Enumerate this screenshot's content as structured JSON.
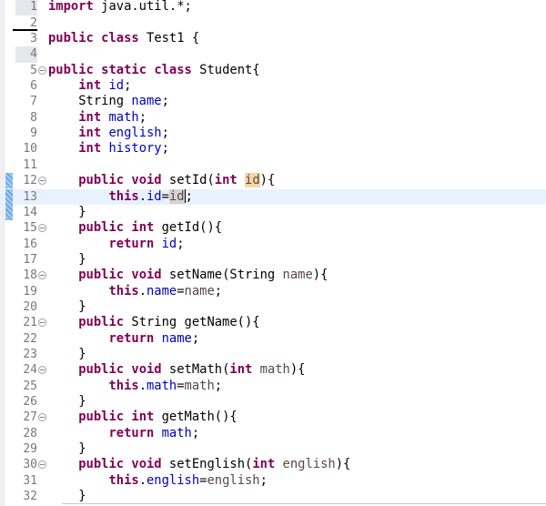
{
  "editor": {
    "current_line": 13,
    "marked_line_numbers": [
      1,
      4
    ],
    "underlined_line_number": 2,
    "selection_marker_lines": [
      12,
      13,
      14
    ],
    "caret": {
      "line": 13,
      "after_token": 4
    },
    "lines": [
      {
        "n": "1",
        "tokens": [
          [
            "k",
            "import"
          ],
          [
            "n",
            " java.util.*;"
          ]
        ]
      },
      {
        "n": "2",
        "tokens": []
      },
      {
        "n": "3",
        "tokens": [
          [
            "k",
            "public"
          ],
          [
            "n",
            " "
          ],
          [
            "k",
            "class"
          ],
          [
            "n",
            " Test1 {"
          ]
        ]
      },
      {
        "n": "4",
        "tokens": []
      },
      {
        "n": "5",
        "fold": true,
        "tokens": [
          [
            "k",
            "public"
          ],
          [
            "n",
            " "
          ],
          [
            "k",
            "static"
          ],
          [
            "n",
            " "
          ],
          [
            "k",
            "class"
          ],
          [
            "n",
            " Student{"
          ]
        ]
      },
      {
        "n": "6",
        "tokens": [
          [
            "n",
            "    "
          ],
          [
            "k",
            "int"
          ],
          [
            "n",
            " "
          ],
          [
            "f",
            "id"
          ],
          [
            "n",
            ";"
          ]
        ]
      },
      {
        "n": "7",
        "tokens": [
          [
            "n",
            "    String "
          ],
          [
            "f",
            "name"
          ],
          [
            "n",
            ";"
          ]
        ]
      },
      {
        "n": "8",
        "tokens": [
          [
            "n",
            "    "
          ],
          [
            "k",
            "int"
          ],
          [
            "n",
            " "
          ],
          [
            "f",
            "math"
          ],
          [
            "n",
            ";"
          ]
        ]
      },
      {
        "n": "9",
        "tokens": [
          [
            "n",
            "    "
          ],
          [
            "k",
            "int"
          ],
          [
            "n",
            " "
          ],
          [
            "f",
            "english"
          ],
          [
            "n",
            ";"
          ]
        ]
      },
      {
        "n": "10",
        "tokens": [
          [
            "n",
            "    "
          ],
          [
            "k",
            "int"
          ],
          [
            "n",
            " "
          ],
          [
            "f",
            "history"
          ],
          [
            "n",
            ";"
          ]
        ]
      },
      {
        "n": "11",
        "tokens": []
      },
      {
        "n": "12",
        "fold": true,
        "tokens": [
          [
            "n",
            "    "
          ],
          [
            "k",
            "public"
          ],
          [
            "n",
            " "
          ],
          [
            "k",
            "void"
          ],
          [
            "n",
            " setId("
          ],
          [
            "k",
            "int"
          ],
          [
            "n",
            " "
          ],
          [
            "hp",
            "id"
          ],
          [
            "n",
            "){"
          ]
        ]
      },
      {
        "n": "13",
        "tokens": [
          [
            "n",
            "        "
          ],
          [
            "k",
            "this"
          ],
          [
            "n",
            "."
          ],
          [
            "f",
            "id"
          ],
          [
            "n",
            "="
          ],
          [
            "hr",
            "id"
          ],
          [
            "n",
            ";"
          ]
        ]
      },
      {
        "n": "14",
        "tokens": [
          [
            "n",
            "    }"
          ]
        ]
      },
      {
        "n": "15",
        "fold": true,
        "tokens": [
          [
            "n",
            "    "
          ],
          [
            "k",
            "public"
          ],
          [
            "n",
            " "
          ],
          [
            "k",
            "int"
          ],
          [
            "n",
            " getId(){"
          ]
        ]
      },
      {
        "n": "16",
        "tokens": [
          [
            "n",
            "        "
          ],
          [
            "k",
            "return"
          ],
          [
            "n",
            " "
          ],
          [
            "f",
            "id"
          ],
          [
            "n",
            ";"
          ]
        ]
      },
      {
        "n": "17",
        "tokens": [
          [
            "n",
            "    }"
          ]
        ]
      },
      {
        "n": "18",
        "fold": true,
        "tokens": [
          [
            "n",
            "    "
          ],
          [
            "k",
            "public"
          ],
          [
            "n",
            " "
          ],
          [
            "k",
            "void"
          ],
          [
            "n",
            " setName(String "
          ],
          [
            "p",
            "name"
          ],
          [
            "n",
            "){"
          ]
        ]
      },
      {
        "n": "19",
        "tokens": [
          [
            "n",
            "        "
          ],
          [
            "k",
            "this"
          ],
          [
            "n",
            "."
          ],
          [
            "f",
            "name"
          ],
          [
            "n",
            "="
          ],
          [
            "p",
            "name"
          ],
          [
            "n",
            ";"
          ]
        ]
      },
      {
        "n": "20",
        "tokens": [
          [
            "n",
            "    }"
          ]
        ]
      },
      {
        "n": "21",
        "fold": true,
        "tokens": [
          [
            "n",
            "    "
          ],
          [
            "k",
            "public"
          ],
          [
            "n",
            " String getName(){"
          ]
        ]
      },
      {
        "n": "22",
        "tokens": [
          [
            "n",
            "        "
          ],
          [
            "k",
            "return"
          ],
          [
            "n",
            " "
          ],
          [
            "f",
            "name"
          ],
          [
            "n",
            ";"
          ]
        ]
      },
      {
        "n": "23",
        "tokens": [
          [
            "n",
            "    }"
          ]
        ]
      },
      {
        "n": "24",
        "fold": true,
        "tokens": [
          [
            "n",
            "    "
          ],
          [
            "k",
            "public"
          ],
          [
            "n",
            " "
          ],
          [
            "k",
            "void"
          ],
          [
            "n",
            " setMath("
          ],
          [
            "k",
            "int"
          ],
          [
            "n",
            " "
          ],
          [
            "p",
            "math"
          ],
          [
            "n",
            "){"
          ]
        ]
      },
      {
        "n": "25",
        "tokens": [
          [
            "n",
            "        "
          ],
          [
            "k",
            "this"
          ],
          [
            "n",
            "."
          ],
          [
            "f",
            "math"
          ],
          [
            "n",
            "="
          ],
          [
            "p",
            "math"
          ],
          [
            "n",
            ";"
          ]
        ]
      },
      {
        "n": "26",
        "tokens": [
          [
            "n",
            "    }"
          ]
        ]
      },
      {
        "n": "27",
        "fold": true,
        "tokens": [
          [
            "n",
            "    "
          ],
          [
            "k",
            "public"
          ],
          [
            "n",
            " "
          ],
          [
            "k",
            "int"
          ],
          [
            "n",
            " getMath(){"
          ]
        ]
      },
      {
        "n": "28",
        "tokens": [
          [
            "n",
            "        "
          ],
          [
            "k",
            "return"
          ],
          [
            "n",
            " "
          ],
          [
            "f",
            "math"
          ],
          [
            "n",
            ";"
          ]
        ]
      },
      {
        "n": "29",
        "tokens": [
          [
            "n",
            "    }"
          ]
        ]
      },
      {
        "n": "30",
        "fold": true,
        "tokens": [
          [
            "n",
            "    "
          ],
          [
            "k",
            "public"
          ],
          [
            "n",
            " "
          ],
          [
            "k",
            "void"
          ],
          [
            "n",
            " setEnglish("
          ],
          [
            "k",
            "int"
          ],
          [
            "n",
            " "
          ],
          [
            "p",
            "english"
          ],
          [
            "n",
            "){"
          ]
        ]
      },
      {
        "n": "31",
        "tokens": [
          [
            "n",
            "        "
          ],
          [
            "k",
            "this"
          ],
          [
            "n",
            "."
          ],
          [
            "f",
            "english"
          ],
          [
            "n",
            "="
          ],
          [
            "p",
            "english"
          ],
          [
            "n",
            ";"
          ]
        ]
      },
      {
        "n": "32",
        "tokens": [
          [
            "n",
            "    }"
          ]
        ]
      }
    ]
  }
}
